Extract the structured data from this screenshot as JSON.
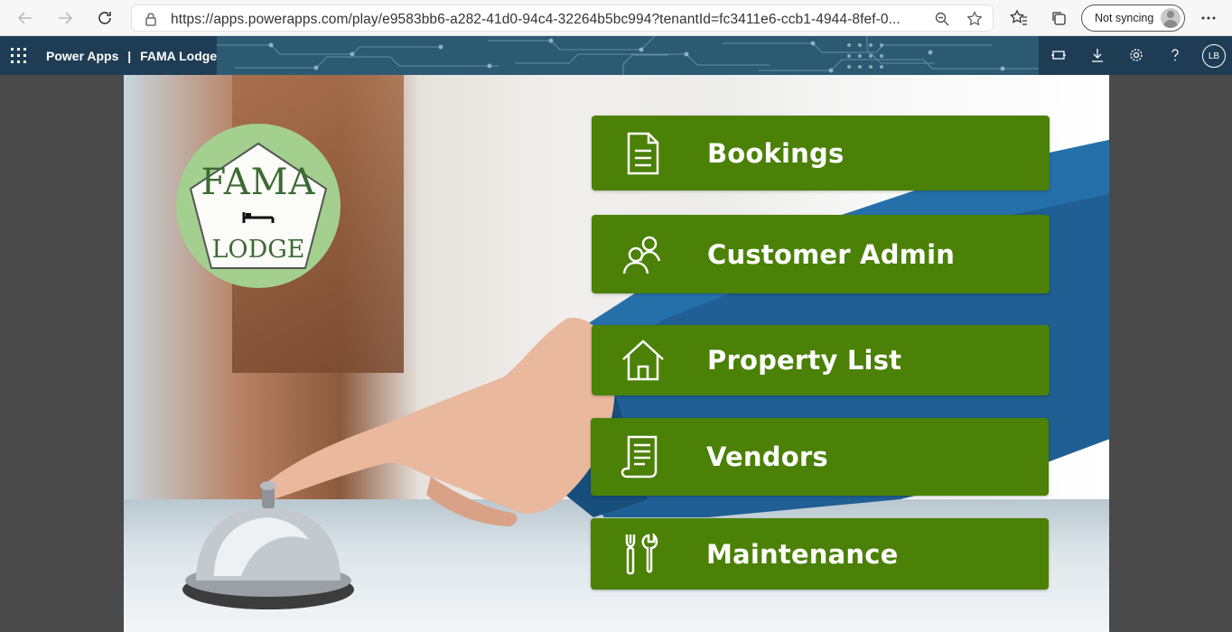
{
  "browser": {
    "url": "https://apps.powerapps.com/play/e9583bb6-a282-41d0-94c4-32264b5bc994?tenantId=fc3411e6-ccb1-4944-8fef-0...",
    "sync_label": "Not syncing"
  },
  "header": {
    "app_name": "Power Apps",
    "separator": "|",
    "app_title": "FAMA Lodge",
    "user_initials": "LB"
  },
  "logo": {
    "line1": "FAMA",
    "line2": "LODGE"
  },
  "menu": {
    "items": [
      {
        "label": "Bookings",
        "icon": "document-icon"
      },
      {
        "label": "Customer Admin",
        "icon": "people-icon"
      },
      {
        "label": "Property List",
        "icon": "house-icon"
      },
      {
        "label": "Vendors",
        "icon": "receipt-icon"
      },
      {
        "label": "Maintenance",
        "icon": "tools-icon"
      }
    ]
  },
  "colors": {
    "button_green": "#4a8106",
    "header_navy": "#1e3d55",
    "logo_green": "#a3d08e"
  }
}
